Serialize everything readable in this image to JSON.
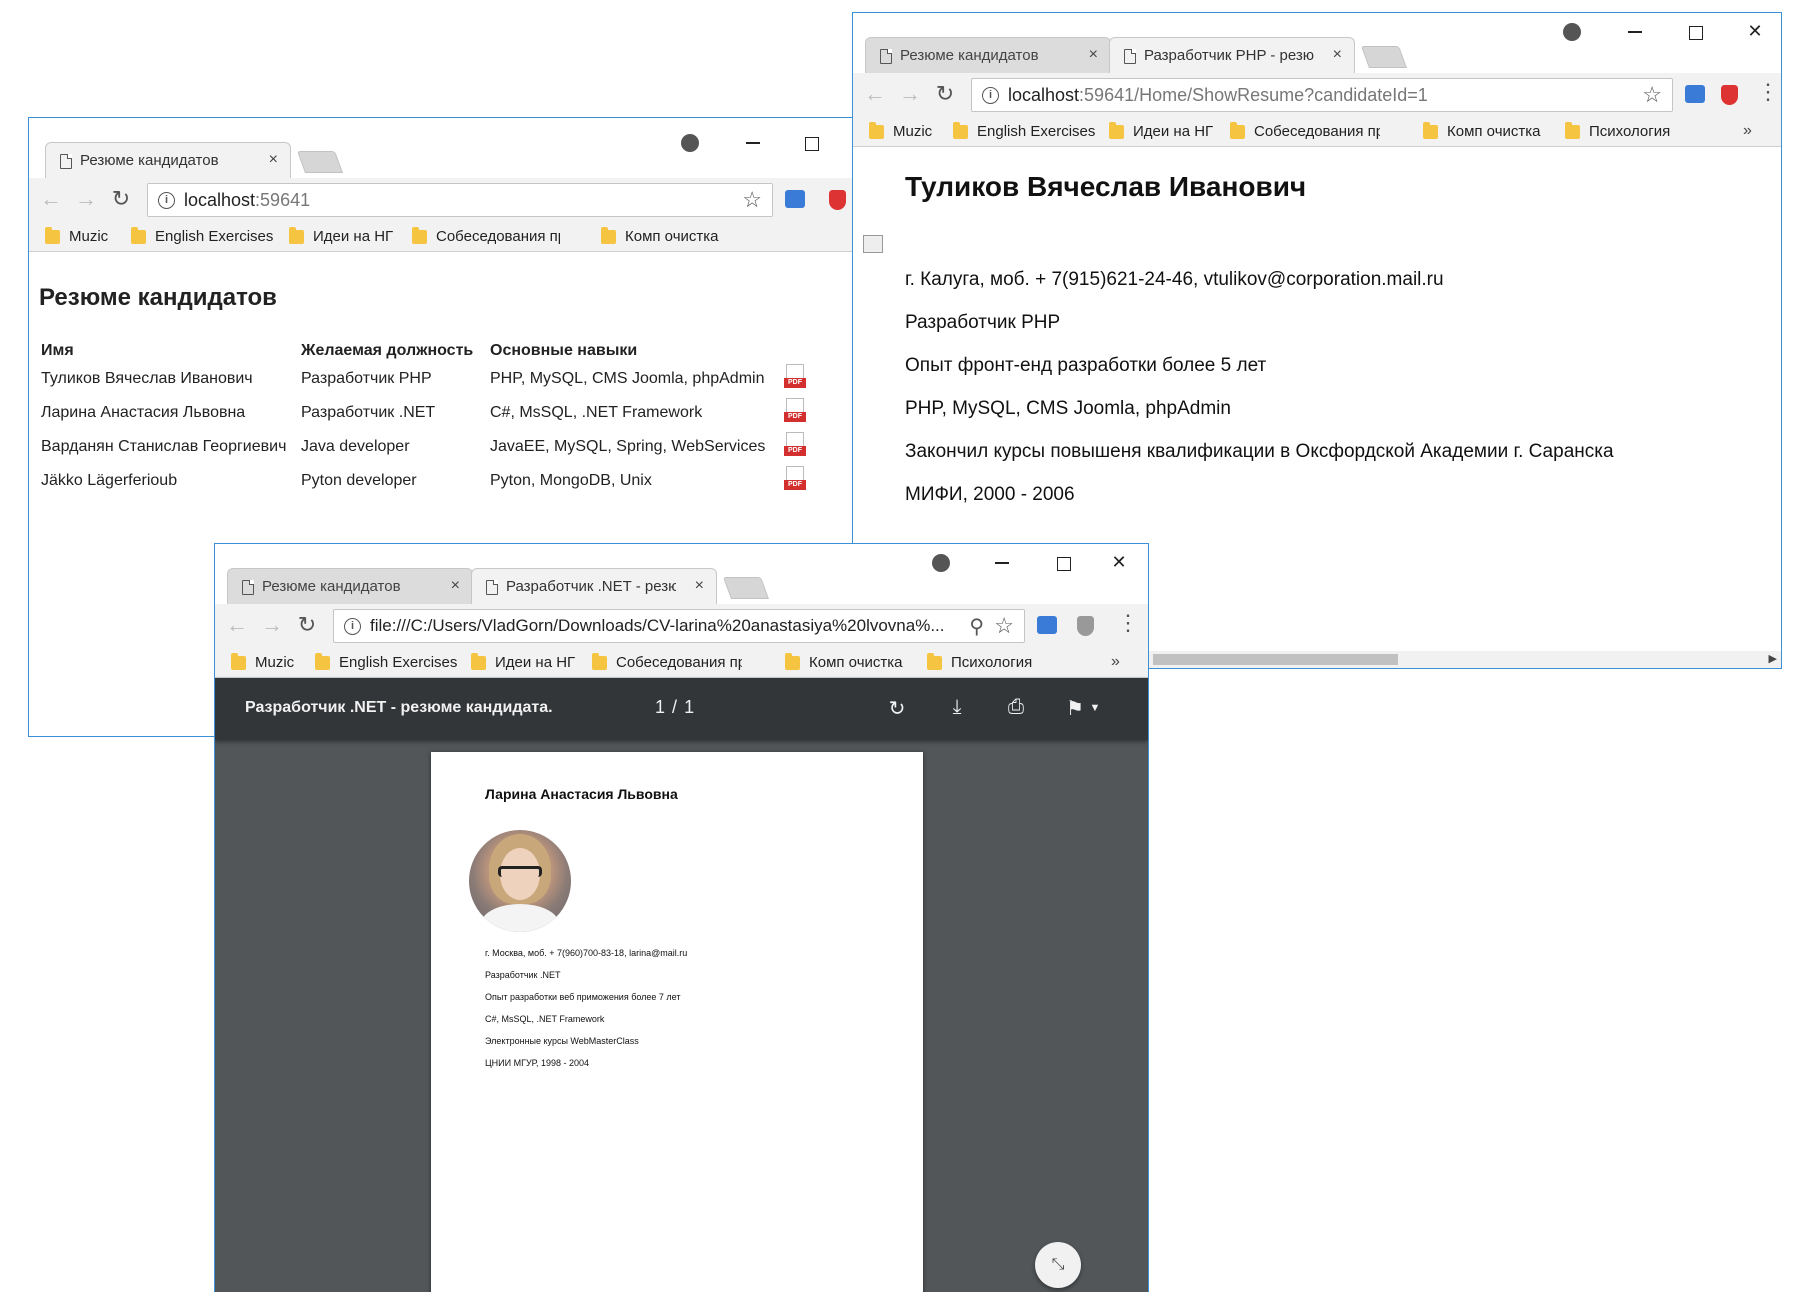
{
  "window1": {
    "tab_active": "Резюме кандидатов",
    "url": {
      "host": "localhost",
      "port": ":59641"
    },
    "bookmarks": [
      "Muzic",
      "English Exercises",
      "Идеи на НГ",
      "Собеседования при",
      "Комп очистка"
    ],
    "page_title": "Резюме кандидатов",
    "table": {
      "headers": [
        "Имя",
        "Желаемая должность",
        "Основные навыки"
      ],
      "rows": [
        [
          "Туликов Вячеслав Иванович",
          "Разработчик PHP",
          "PHP, MySQL, CMS Joomla, phpAdmin"
        ],
        [
          "Ларина Анастасия Львовна",
          "Разработчик .NET",
          "C#, MsSQL, .NET Framework"
        ],
        [
          "Варданян Станислав Георгиевич",
          "Java developer",
          "JavaEE, MySQL, Spring, WebServices"
        ],
        [
          "Jäkko Lägerferioub",
          "Pyton developer",
          "Pyton, MongoDB, Unix"
        ]
      ],
      "pdf_label": "PDF"
    }
  },
  "window2": {
    "tabs": [
      "Резюме кандидатов",
      "Разработчик PHP - резю"
    ],
    "url": {
      "host": "localhost",
      "rest": ":59641/Home/ShowResume?candidateId=1"
    },
    "bookmarks": [
      "Muzic",
      "English Exercises",
      "Идеи на НГ",
      "Собеседования при",
      "Комп очистка",
      "Психология"
    ],
    "bookmarks_more": "»",
    "name": "Туликов Вячеслав Иванович",
    "lines": [
      "г. Калуга, моб. + 7(915)621-24-46, vtulikov@corporation.mail.ru",
      "Разработчик PHP",
      "Опыт фронт-енд разработки более 5 лет",
      "PHP, MySQL, CMS Joomla, phpAdmin",
      "Закончил курсы повышеня квалификации в Оксфордской Академии г. Саранска",
      "МИФИ, 2000 - 2006"
    ]
  },
  "window3": {
    "tabs": [
      "Резюме кандидатов",
      "Разработчик .NET - резю"
    ],
    "url": "file:///C:/Users/VladGorn/Downloads/CV-larina%20anastasiya%20lvovna%...",
    "bookmarks": [
      "Muzic",
      "English Exercises",
      "Идеи на НГ",
      "Собеседования при",
      "Комп очистка",
      "Психология"
    ],
    "bookmarks_more": "»",
    "pdf_title": "Разработчик .NET - резюме кандидата.",
    "page_current": "1",
    "page_sep": "/",
    "page_total": "1",
    "doc": {
      "name": "Ларина Анастасия Львовна",
      "lines": [
        "г. Москва, моб. + 7(960)700-83-18, larina@mail.ru",
        "Разработчик .NET",
        "Опыт разработки веб приможения более 7 лет",
        "C#, MsSQL, .NET Framework",
        "Электронные курсы WebMasterClass",
        "ЦНИИ МГУР, 1998 - 2004"
      ]
    }
  },
  "icons": {
    "close": "×",
    "back": "←",
    "forward": "→",
    "reload": "↻",
    "star": "☆",
    "zoom": "⚲",
    "menu": "⋮",
    "win_close": "✕",
    "rotate": "↻",
    "download": "⤓",
    "print": "⎙",
    "bookmark": "⚑",
    "fit": "⤡"
  },
  "colors": {
    "window_border": "#3d8fd6",
    "pdf_toolbar": "#323639",
    "pdf_background": "#525659",
    "pdf_badge": "#d32f2f"
  }
}
